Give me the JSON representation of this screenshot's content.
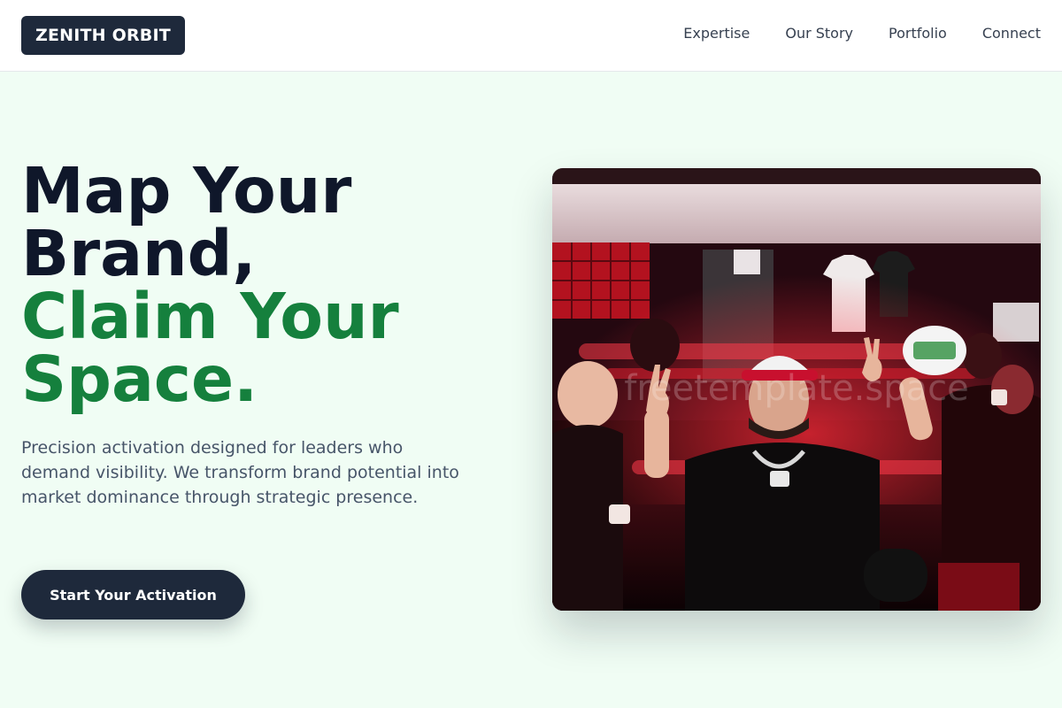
{
  "header": {
    "logo": "ZENITH ORBIT",
    "nav": [
      "Expertise",
      "Our Story",
      "Portfolio",
      "Connect"
    ]
  },
  "hero": {
    "title_lines": [
      "Map Your",
      "Brand,",
      "Claim Your",
      "Space."
    ],
    "subtitle": "Precision activation designed for leaders who demand visibility. We transform brand potential into market dominance through strategic presence.",
    "cta_label": "Start Your Activation",
    "image_watermark": "freetemplate.space"
  },
  "colors": {
    "primary_dark": "#1e293b",
    "accent_green": "#15803d",
    "page_background": "#f0fdf4"
  }
}
